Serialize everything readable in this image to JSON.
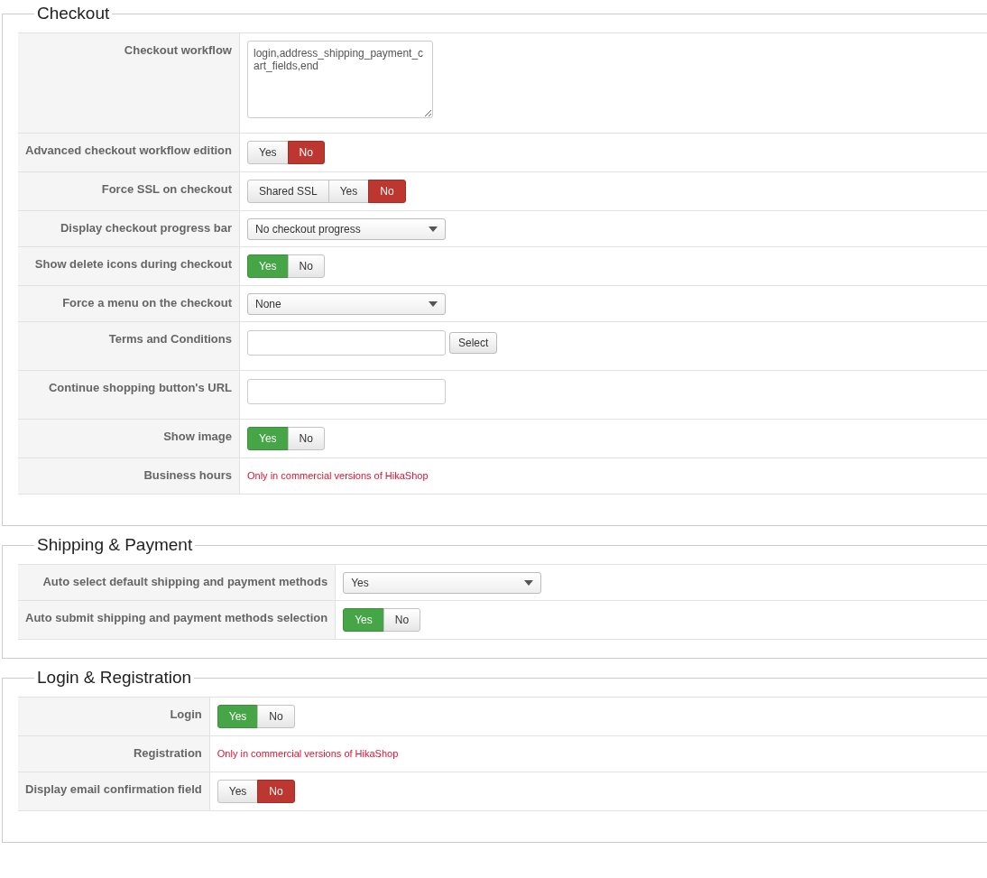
{
  "sections": [
    {
      "title": "Checkout",
      "rows": [
        {
          "label": "Checkout workflow",
          "kind": "textarea",
          "value": "login,address_shipping_payment_cart_fields,end"
        },
        {
          "label": "Advanced checkout workflow edition",
          "kind": "toggle",
          "options": [
            {
              "label": "Yes",
              "selected": false
            },
            {
              "label": "No",
              "kind": "negative",
              "selected": true
            }
          ]
        },
        {
          "label": "Force SSL on checkout",
          "kind": "toggle",
          "options": [
            {
              "label": "Shared SSL",
              "selected": false
            },
            {
              "label": "Yes",
              "selected": false
            },
            {
              "label": "No",
              "kind": "negative",
              "selected": true
            }
          ]
        },
        {
          "label": "Display checkout progress bar",
          "kind": "select",
          "value": "No checkout progress"
        },
        {
          "label": "Show delete icons during checkout",
          "kind": "toggle",
          "options": [
            {
              "label": "Yes",
              "kind": "positive",
              "selected": true
            },
            {
              "label": "No",
              "selected": false
            }
          ]
        },
        {
          "label": "Force a menu on the checkout",
          "kind": "select",
          "value": "None"
        },
        {
          "label": "Terms and Conditions",
          "kind": "text_button",
          "button": "Select"
        },
        {
          "label": "Continue shopping button's URL",
          "kind": "text"
        },
        {
          "label": "Show image",
          "kind": "toggle",
          "options": [
            {
              "label": "Yes",
              "kind": "positive",
              "selected": true
            },
            {
              "label": "No",
              "selected": false
            }
          ]
        },
        {
          "label": "Business hours",
          "kind": "notice",
          "text": "Only in commercial versions of HikaShop"
        }
      ]
    },
    {
      "title": "Shipping & Payment",
      "rows": [
        {
          "label": "Auto select default shipping and payment methods",
          "kind": "select",
          "value": "Yes"
        },
        {
          "label": "Auto submit shipping and payment methods selection",
          "kind": "toggle",
          "options": [
            {
              "label": "Yes",
              "kind": "positive",
              "selected": true
            },
            {
              "label": "No",
              "selected": false
            }
          ]
        }
      ]
    },
    {
      "title": "Login & Registration",
      "rows": [
        {
          "label": "Login",
          "kind": "toggle",
          "options": [
            {
              "label": "Yes",
              "kind": "positive",
              "selected": true
            },
            {
              "label": "No",
              "selected": false
            }
          ]
        },
        {
          "label": "Registration",
          "kind": "notice",
          "text": "Only in commercial versions of HikaShop"
        },
        {
          "label": "Display email confirmation field",
          "kind": "toggle",
          "options": [
            {
              "label": "Yes",
              "selected": false
            },
            {
              "label": "No",
              "kind": "negative",
              "selected": true
            }
          ]
        }
      ]
    }
  ]
}
